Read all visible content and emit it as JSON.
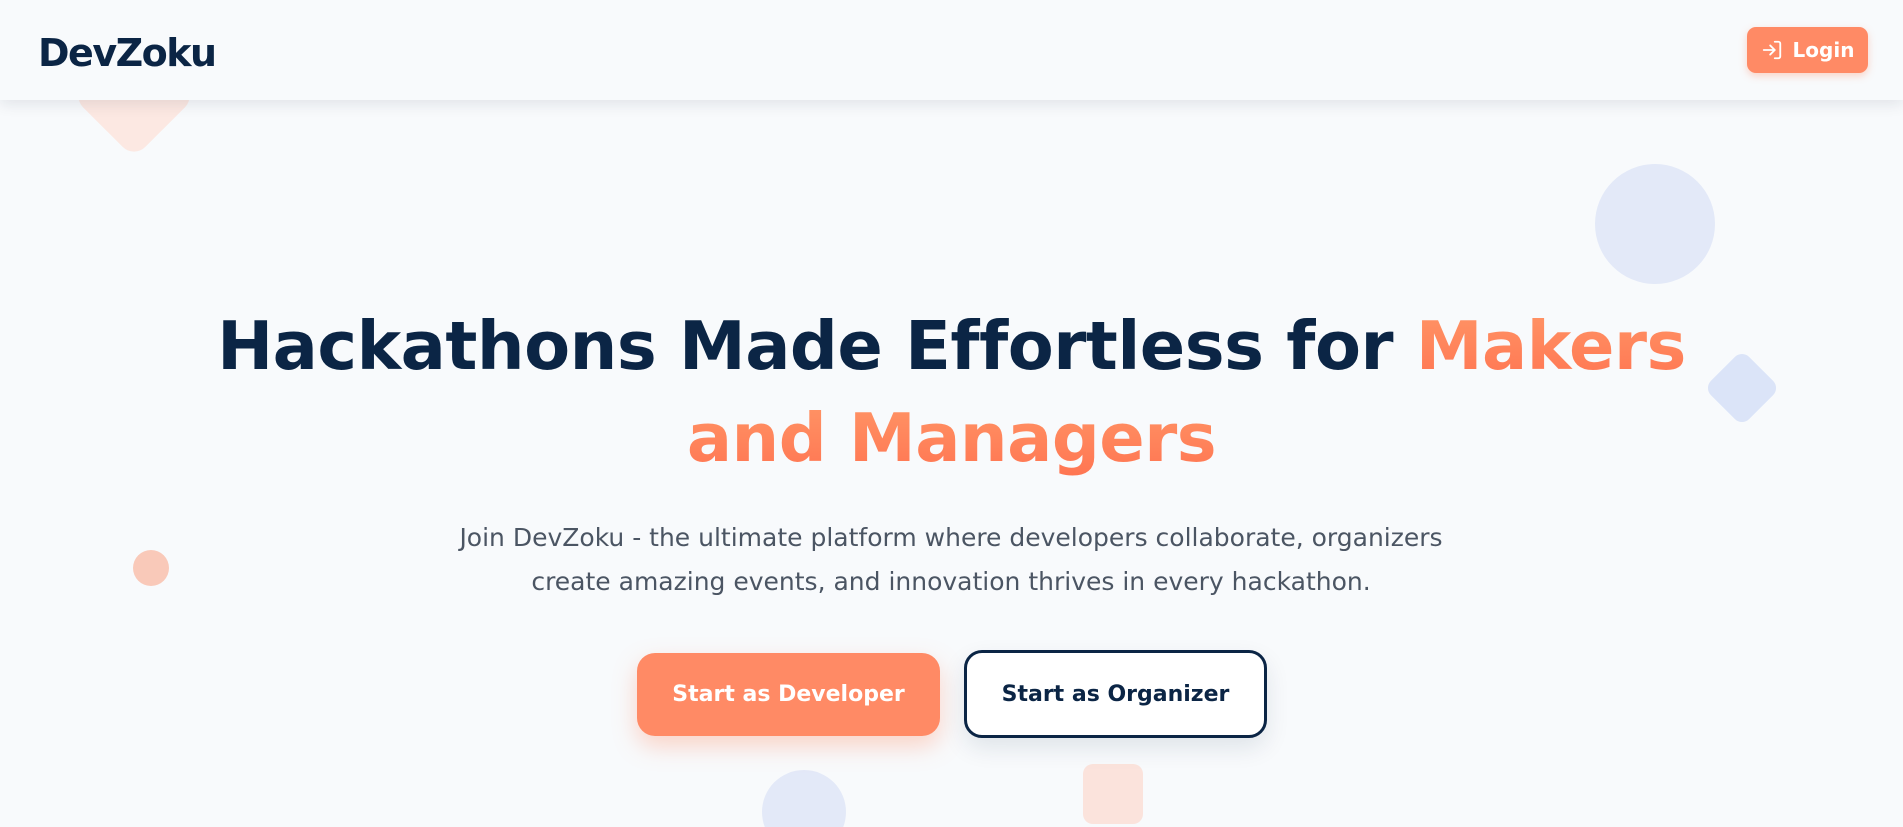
{
  "header": {
    "logo": "DevZoku",
    "login_label": "Login",
    "login_icon": "login-arrow-icon"
  },
  "hero": {
    "title_main": "Hackathons Made Effortless for ",
    "title_accent": "Makers and Managers",
    "subtitle": "Join DevZoku - the ultimate platform where developers collaborate, organizers create amazing events, and innovation thrives in every hackathon.",
    "primary_cta": "Start as Developer",
    "secondary_cta": "Start as Organizer"
  },
  "colors": {
    "brand_dark": "#0b2545",
    "accent": "#ff8a65",
    "text_muted": "#4b5563",
    "background": "#f8fafc"
  }
}
